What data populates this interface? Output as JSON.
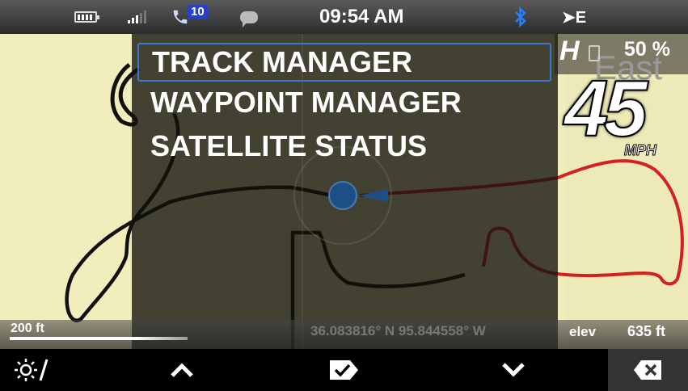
{
  "status_bar": {
    "battery_icon": "battery-icon",
    "signal_icon": "signal-bars-icon",
    "phone_icon": "phone-icon",
    "missed_calls": "10",
    "message_icon": "chat-bubble-icon",
    "time": "09:54 AM",
    "bluetooth_icon": "bluetooth-icon",
    "heading": "➤E"
  },
  "menu": {
    "items": [
      {
        "label": "TRACK MANAGER",
        "selected": true
      },
      {
        "label": "WAYPOINT MANAGER",
        "selected": false
      },
      {
        "label": "SATELLITE STATUS",
        "selected": false
      }
    ]
  },
  "hud": {
    "gear": "H",
    "fuel_icon": "fuel-pump-icon",
    "fuel_percent": "50 %",
    "road_name": "East",
    "speed": "45",
    "speed_unit": "MPH"
  },
  "info_bar": {
    "scale": "200 ft",
    "coordinates": "36.083816° N 95.844558° W",
    "elev_label": "elev",
    "elev_value": "635 ft"
  },
  "toolbar": {
    "day_night_icon": "day-night-toggle-icon",
    "up_icon": "chevron-up-icon",
    "select_icon": "select-tag-check-icon",
    "down_icon": "chevron-down-icon",
    "back_icon": "backspace-icon"
  },
  "colors": {
    "map_background": "#f1edbd",
    "track_line": "#d42020",
    "trail_line": "#111111",
    "position_marker": "#1c4f86",
    "selection_border": "#3c78d0",
    "missed_call_badge": "#2840c8",
    "bluetooth": "#2a7fff"
  }
}
